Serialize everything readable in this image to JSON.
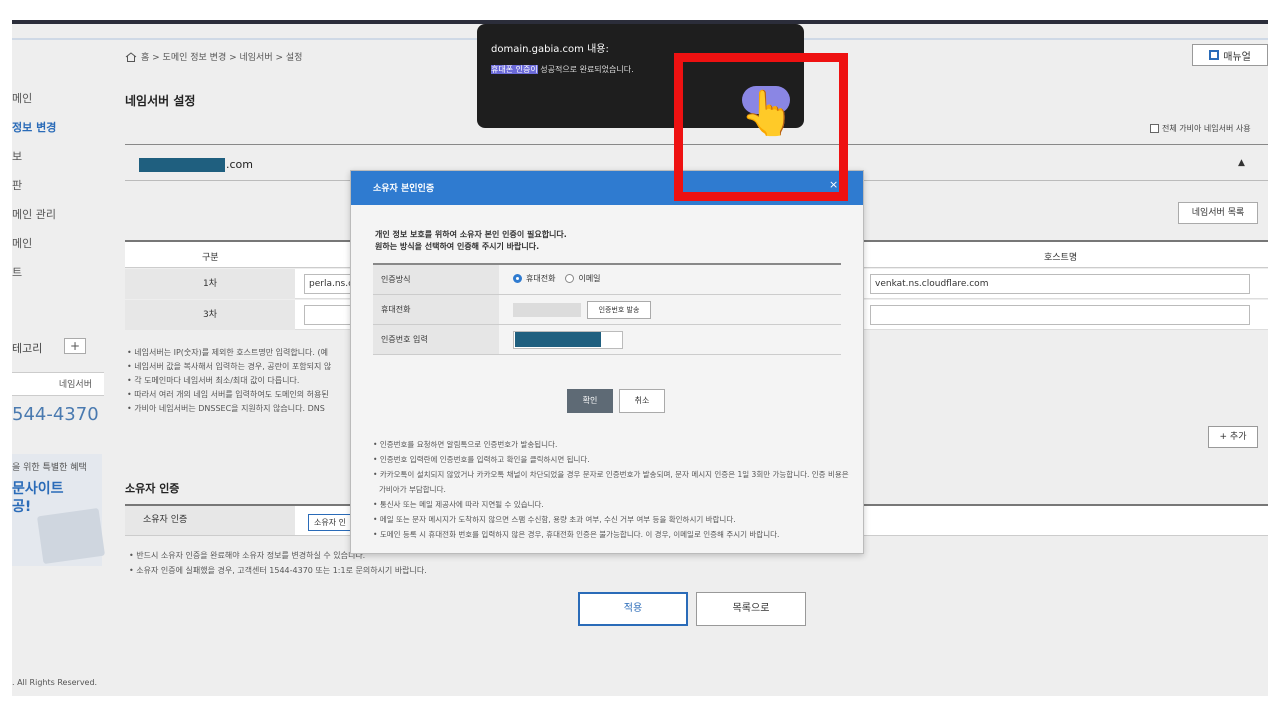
{
  "breadcrumb": "홈 > 도메인 정보 변경 > 네임서버 > 설정",
  "manual_button": "매뉴얼",
  "sidebar": {
    "items": [
      "메인",
      "정보 변경",
      "보",
      "판",
      "메인 관리",
      "메인",
      "트"
    ],
    "category_label": "테고리",
    "tab_label": "네임서버",
    "phone": "544-4370",
    "banner_line1": "을 위한 특별한 혜택",
    "banner_line2": "문사이트",
    "banner_line3": "공!"
  },
  "page_title": "네임서버 설정",
  "all_nameserver_label": "전체 가비아 네임서버 사용",
  "domain_suffix": ".com",
  "collapse_arrow": "▲",
  "nameserver_list_button": "네임서버 목록",
  "table": {
    "header_gubun": "구분",
    "header_host": "호스트명",
    "rows": [
      {
        "label": "1차",
        "value": "perla.ns.cl",
        "host_right": "venkat.ns.cloudflare.com"
      },
      {
        "label": "3차",
        "value": "",
        "host_right": ""
      }
    ]
  },
  "notes": [
    "네임서버는 IP(숫자)를 제외한 호스트명만 입력합니다. (예",
    "네임서버 값을 복사해서 입력하는 경우, 공란이 포함되지 않",
    "각 도메인마다 네임서버 최소/최대 값이 다릅니다.",
    "따라서 여러 개의 네임 서버를 입력하여도 도메인의 허용된",
    "가비아 네임서버는 DNSSEC을 지원하지 않습니다. DNS"
  ],
  "add_button": "+ 추가",
  "owner": {
    "title": "소유자 인증",
    "label": "소유자 인증",
    "button": "소유자 인",
    "notes": [
      "반드시 소유자 인증을 완료해야 소유자 정보를 변경하실 수 있습니다.",
      "소유자 인증에 실패했을 경우, 고객센터 1544-4370 또는 1:1로 문의하시기 바랍니다."
    ]
  },
  "apply_button": "적용",
  "list_button": "목록으로",
  "footer": ". All Rights Reserved.",
  "modal": {
    "title": "소유자 본인인증",
    "close": "×",
    "intro_line1": "개인 정보 보호를 위하여 소유자 본인 인증이 필요합니다.",
    "intro_line2": "원하는 방식을 선택하여 인증해 주시기 바랍니다.",
    "method_label": "인증방식",
    "method_phone": "휴대전화",
    "method_email": "이메일",
    "phone_label": "휴대전화",
    "send_code_button": "인증번호 발송",
    "code_label": "인증번호 입력",
    "confirm_button": "확인",
    "cancel_button": "취소",
    "notes": [
      "인증번호를 요청하면 알림톡으로 인증번호가 발송됩니다.",
      "인증번호 입력란에 인증번호를 입력하고 확인을 클릭하시면 됩니다.",
      "카카오톡이 설치되지 않았거나 카카오톡 채널이 차단되었을 경우 문자로 인증번호가 발송되며, 문자 메시지 인증은 1일 3회만 가능합니다. 인증 비용은 가비아가 부담합니다.",
      "통신사 또는 메일 제공사에 따라 지연될 수 있습니다.",
      "메일 또는 문자 메시지가 도착하지 않으면 스팸 수신함, 용량 초과 여부, 수신 거부 여부 등을 확인하시기 바랍니다.",
      "도메인 등록 시 휴대전화 번호를 입력하지 않은 경우, 휴대전화 인증은 불가능합니다. 이 경우, 이메일로 인증해 주시기 바랍니다."
    ]
  },
  "alert": {
    "title": "domain.gabia.com 내용:",
    "highlight": "휴대폰 인증이",
    "message": " 성공적으로 완료되었습니다."
  },
  "colors": {
    "accent": "#2f7bd0",
    "highlight_box": "#ee1111",
    "alert_bg": "#1e1e1e"
  }
}
